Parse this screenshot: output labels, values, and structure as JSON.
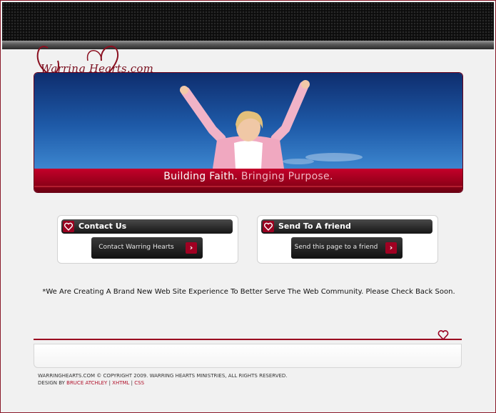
{
  "logo": {
    "text": "Warring Hearts.com"
  },
  "hero": {
    "tagline_main": "Building Faith.",
    "tagline_accent": "Bringing Purpose."
  },
  "boxes": [
    {
      "title": "Contact Us",
      "button_label": "Contact Warring Hearts"
    },
    {
      "title": "Send To A friend",
      "button_label": "Send this page to a friend"
    }
  ],
  "notice": "*We Are Creating A Brand New Web Site Experience To Better Serve The Web Community. Please Check Back Soon.",
  "footer": {
    "copyright": "WARRINGHEARTS.COM © COPYRIGHT 2009. WARRING HEARTS MINISTRIES, ALL RIGHTS RESERVED.",
    "design_by": "DESIGN BY",
    "designer": "BRUCE ATCHLEY",
    "sep1": "|",
    "xhtml": "XHTML",
    "sep2": "|",
    "css": "CSS"
  },
  "colors": {
    "accent": "#9a0020",
    "sky": "#1e5aa8",
    "dark": "#151515"
  },
  "icons": {
    "heart": "heart-icon",
    "arrow": "chevron-right-icon"
  }
}
